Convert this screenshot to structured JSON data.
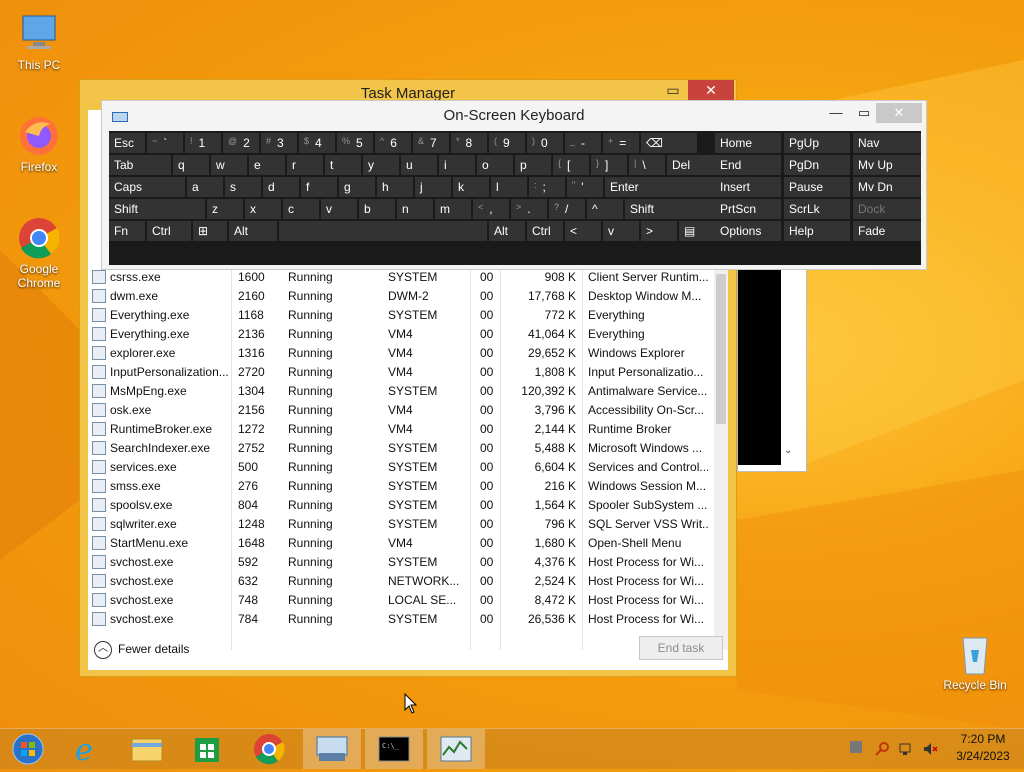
{
  "desktop": {
    "icons": [
      {
        "label": "This PC",
        "icon": "computer-icon"
      },
      {
        "label": "Firefox",
        "icon": "firefox-icon"
      },
      {
        "label": "Google Chrome",
        "icon": "chrome-icon"
      },
      {
        "label": "Recycle Bin",
        "icon": "recycle-bin-icon"
      }
    ]
  },
  "task_manager": {
    "title": "Task Manager",
    "controls": {
      "minimize": "▭",
      "maximize": "▢",
      "close": "✕"
    },
    "rows": [
      {
        "name": "csrss.exe",
        "pid": "1600",
        "status": "Running",
        "user": "SYSTEM",
        "cpu": "00",
        "mem": "908 K",
        "desc": "Client Server Runtim..."
      },
      {
        "name": "dwm.exe",
        "pid": "2160",
        "status": "Running",
        "user": "DWM-2",
        "cpu": "00",
        "mem": "17,768 K",
        "desc": "Desktop Window M..."
      },
      {
        "name": "Everything.exe",
        "pid": "1168",
        "status": "Running",
        "user": "SYSTEM",
        "cpu": "00",
        "mem": "772 K",
        "desc": "Everything"
      },
      {
        "name": "Everything.exe",
        "pid": "2136",
        "status": "Running",
        "user": "VM4",
        "cpu": "00",
        "mem": "41,064 K",
        "desc": "Everything"
      },
      {
        "name": "explorer.exe",
        "pid": "1316",
        "status": "Running",
        "user": "VM4",
        "cpu": "00",
        "mem": "29,652 K",
        "desc": "Windows Explorer"
      },
      {
        "name": "InputPersonalization...",
        "pid": "2720",
        "status": "Running",
        "user": "VM4",
        "cpu": "00",
        "mem": "1,808 K",
        "desc": "Input Personalizatio..."
      },
      {
        "name": "MsMpEng.exe",
        "pid": "1304",
        "status": "Running",
        "user": "SYSTEM",
        "cpu": "00",
        "mem": "120,392 K",
        "desc": "Antimalware Service..."
      },
      {
        "name": "osk.exe",
        "pid": "2156",
        "status": "Running",
        "user": "VM4",
        "cpu": "00",
        "mem": "3,796 K",
        "desc": "Accessibility On-Scr..."
      },
      {
        "name": "RuntimeBroker.exe",
        "pid": "1272",
        "status": "Running",
        "user": "VM4",
        "cpu": "00",
        "mem": "2,144 K",
        "desc": "Runtime Broker"
      },
      {
        "name": "SearchIndexer.exe",
        "pid": "2752",
        "status": "Running",
        "user": "SYSTEM",
        "cpu": "00",
        "mem": "5,488 K",
        "desc": "Microsoft Windows ..."
      },
      {
        "name": "services.exe",
        "pid": "500",
        "status": "Running",
        "user": "SYSTEM",
        "cpu": "00",
        "mem": "6,604 K",
        "desc": "Services and Control..."
      },
      {
        "name": "smss.exe",
        "pid": "276",
        "status": "Running",
        "user": "SYSTEM",
        "cpu": "00",
        "mem": "216 K",
        "desc": "Windows Session M..."
      },
      {
        "name": "spoolsv.exe",
        "pid": "804",
        "status": "Running",
        "user": "SYSTEM",
        "cpu": "00",
        "mem": "1,564 K",
        "desc": "Spooler SubSystem ..."
      },
      {
        "name": "sqlwriter.exe",
        "pid": "1248",
        "status": "Running",
        "user": "SYSTEM",
        "cpu": "00",
        "mem": "796 K",
        "desc": "SQL Server VSS Writ..."
      },
      {
        "name": "StartMenu.exe",
        "pid": "1648",
        "status": "Running",
        "user": "VM4",
        "cpu": "00",
        "mem": "1,680 K",
        "desc": "Open-Shell Menu"
      },
      {
        "name": "svchost.exe",
        "pid": "592",
        "status": "Running",
        "user": "SYSTEM",
        "cpu": "00",
        "mem": "4,376 K",
        "desc": "Host Process for Wi..."
      },
      {
        "name": "svchost.exe",
        "pid": "632",
        "status": "Running",
        "user": "NETWORK...",
        "cpu": "00",
        "mem": "2,524 K",
        "desc": "Host Process for Wi..."
      },
      {
        "name": "svchost.exe",
        "pid": "748",
        "status": "Running",
        "user": "LOCAL SE...",
        "cpu": "00",
        "mem": "8,472 K",
        "desc": "Host Process for Wi..."
      },
      {
        "name": "svchost.exe",
        "pid": "784",
        "status": "Running",
        "user": "SYSTEM",
        "cpu": "00",
        "mem": "26,536 K",
        "desc": "Host Process for Wi..."
      }
    ],
    "fewer_details": "Fewer details",
    "end_task": "End task"
  },
  "osk": {
    "title": "On-Screen Keyboard",
    "controls": {
      "minimize": "—",
      "maximize": "▭",
      "close": "✕"
    },
    "rows": [
      [
        {
          "l": "Esc"
        },
        {
          "l": "`",
          "s": "~"
        },
        {
          "l": "1",
          "s": "!"
        },
        {
          "l": "2",
          "s": "@"
        },
        {
          "l": "3",
          "s": "#"
        },
        {
          "l": "4",
          "s": "$"
        },
        {
          "l": "5",
          "s": "%"
        },
        {
          "l": "6",
          "s": "^"
        },
        {
          "l": "7",
          "s": "&"
        },
        {
          "l": "8",
          "s": "*"
        },
        {
          "l": "9",
          "s": "("
        },
        {
          "l": "0",
          "s": ")"
        },
        {
          "l": "-",
          "s": "_"
        },
        {
          "l": "=",
          "s": "+"
        },
        {
          "l": "⌫"
        }
      ],
      [
        {
          "l": "Tab"
        },
        {
          "l": "q"
        },
        {
          "l": "w"
        },
        {
          "l": "e"
        },
        {
          "l": "r"
        },
        {
          "l": "t"
        },
        {
          "l": "y"
        },
        {
          "l": "u"
        },
        {
          "l": "i"
        },
        {
          "l": "o"
        },
        {
          "l": "p"
        },
        {
          "l": "[",
          "s": "{"
        },
        {
          "l": "]",
          "s": "}"
        },
        {
          "l": "\\",
          "s": "|"
        },
        {
          "l": "Del"
        }
      ],
      [
        {
          "l": "Caps"
        },
        {
          "l": "a"
        },
        {
          "l": "s"
        },
        {
          "l": "d"
        },
        {
          "l": "f"
        },
        {
          "l": "g"
        },
        {
          "l": "h"
        },
        {
          "l": "j"
        },
        {
          "l": "k"
        },
        {
          "l": "l"
        },
        {
          "l": ";",
          "s": ":"
        },
        {
          "l": "'",
          "s": "\""
        },
        {
          "l": "Enter"
        }
      ],
      [
        {
          "l": "Shift"
        },
        {
          "l": "z"
        },
        {
          "l": "x"
        },
        {
          "l": "c"
        },
        {
          "l": "v"
        },
        {
          "l": "b"
        },
        {
          "l": "n"
        },
        {
          "l": "m"
        },
        {
          "l": ",",
          "s": "<"
        },
        {
          "l": ".",
          "s": ">"
        },
        {
          "l": "/",
          "s": "?"
        },
        {
          "l": "^"
        },
        {
          "l": "Shift"
        }
      ],
      [
        {
          "l": "Fn"
        },
        {
          "l": "Ctrl"
        },
        {
          "l": "⊞"
        },
        {
          "l": "Alt"
        },
        {
          "l": ""
        },
        {
          "l": "Alt"
        },
        {
          "l": "Ctrl"
        },
        {
          "l": "<"
        },
        {
          "l": "v"
        },
        {
          "l": ">"
        },
        {
          "l": "▤"
        }
      ]
    ],
    "nav_rows": [
      [
        "Home",
        "PgUp",
        "Nav"
      ],
      [
        "End",
        "PgDn",
        "Mv Up"
      ],
      [
        "Insert",
        "Pause",
        "Mv Dn"
      ],
      [
        "PrtScn",
        "ScrLk",
        "Dock"
      ],
      [
        "Options",
        "Help",
        "Fade"
      ]
    ]
  },
  "taskbar": {
    "items": [
      {
        "icon": "start-orb-icon"
      },
      {
        "icon": "internet-explorer-icon"
      },
      {
        "icon": "file-explorer-icon"
      },
      {
        "icon": "store-icon"
      },
      {
        "icon": "chrome-icon"
      },
      {
        "icon": "on-screen-keyboard-icon"
      },
      {
        "icon": "command-prompt-icon"
      },
      {
        "icon": "task-manager-icon"
      }
    ],
    "time": "7:20 PM",
    "date": "3/24/2023"
  }
}
